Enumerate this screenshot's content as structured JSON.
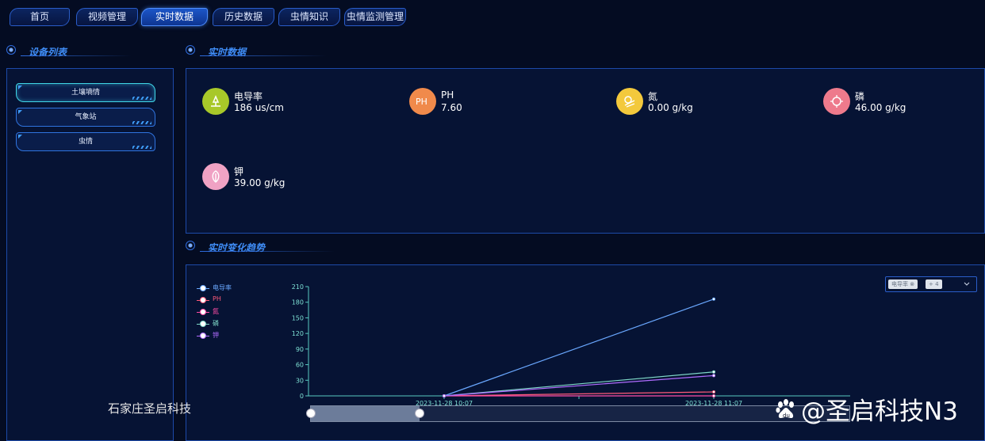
{
  "nav": {
    "tabs": [
      {
        "label": "首页",
        "active": false
      },
      {
        "label": "视频管理",
        "active": false
      },
      {
        "label": "实时数据",
        "active": true
      },
      {
        "label": "历史数据",
        "active": false
      },
      {
        "label": "虫情知识",
        "active": false
      },
      {
        "label": "虫情监测管理",
        "active": false
      }
    ]
  },
  "device_list": {
    "title": "设备列表",
    "items": [
      {
        "label": "土壤墒情",
        "active": true
      },
      {
        "label": "气象站",
        "active": false
      },
      {
        "label": "虫情",
        "active": false
      }
    ]
  },
  "realtime": {
    "title": "实时数据",
    "metrics": [
      {
        "name": "电导率",
        "value": "186 us/cm",
        "icon": "conductivity-icon",
        "color": "#a8c829"
      },
      {
        "name": "PH",
        "value": "7.60",
        "icon": "ph-icon",
        "color": "#f08a4b"
      },
      {
        "name": "氮",
        "value": "0.00 g/kg",
        "icon": "nitrogen-icon",
        "color": "#f3c93c"
      },
      {
        "name": "磷",
        "value": "46.00 g/kg",
        "icon": "phosphorus-icon",
        "color": "#ee7a8c"
      },
      {
        "name": "钾",
        "value": "39.00 g/kg",
        "icon": "potassium-icon",
        "color": "#f0a2c4"
      }
    ]
  },
  "trend": {
    "title": "实时变化趋势",
    "select": {
      "tag1": "电导率",
      "tag2": "+ 4"
    }
  },
  "chart_data": {
    "type": "line",
    "x": [
      "2023-11-28 10:07",
      "2023-11-28 11:07"
    ],
    "ylim": [
      0,
      210
    ],
    "yticks": [
      0,
      30,
      60,
      90,
      120,
      150,
      180,
      210
    ],
    "series": [
      {
        "name": "电导率",
        "values": [
          0,
          186
        ],
        "color": "#6aa8ff"
      },
      {
        "name": "PH",
        "values": [
          0,
          7.6
        ],
        "color": "#ff5a7a"
      },
      {
        "name": "氮",
        "values": [
          0,
          0
        ],
        "color": "#ff4da6"
      },
      {
        "name": "磷",
        "values": [
          0,
          46
        ],
        "color": "#7fd8c8"
      },
      {
        "name": "钾",
        "values": [
          0,
          39
        ],
        "color": "#b06cff"
      }
    ]
  },
  "watermarks": {
    "left": "石家庄圣启科技",
    "right": "@圣启科技N3"
  }
}
